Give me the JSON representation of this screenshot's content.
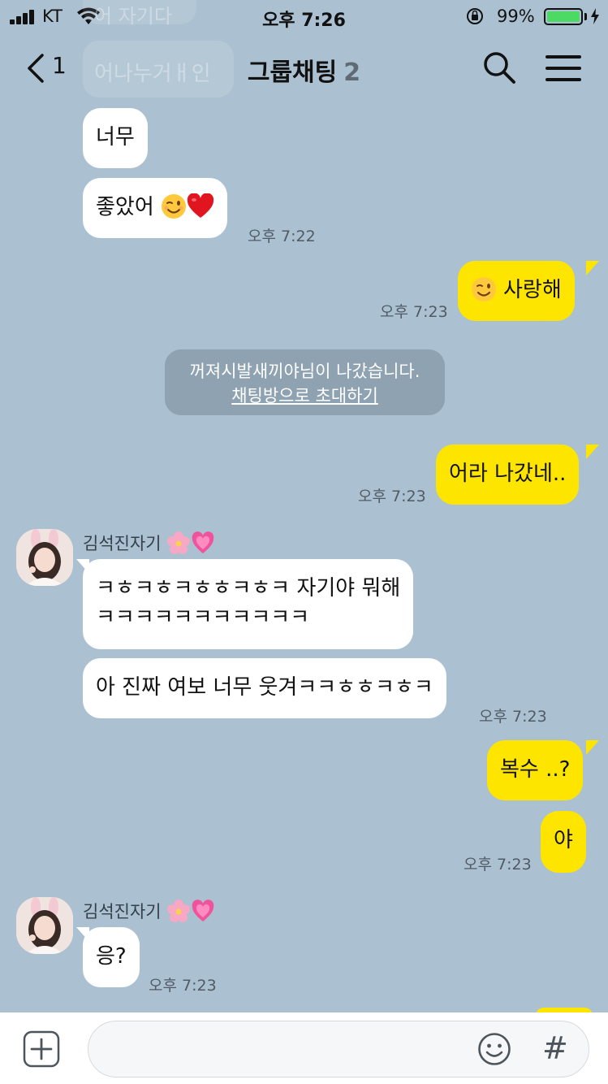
{
  "status_bar": {
    "carrier": "KT",
    "time": "오후 7:26",
    "battery_percent": "99%",
    "battery_level": 0.99
  },
  "header": {
    "unread_count": "1",
    "title": "그룹채팅",
    "member_count": "2",
    "ghost_text_top": "어 자기다",
    "ghost_text": "어나누거ㅐ인"
  },
  "messages": {
    "m1": "너무",
    "m2": "좋았어",
    "t1": "오후 7:22",
    "m3": "사랑해",
    "t2": "오후 7:23",
    "system_notice": "꺼져시발새끼야님이 나갔습니다.",
    "system_link": "채팅방으로 초대하기",
    "m4": "어라 나갔네..",
    "t3": "오후 7:23",
    "sender1": "김석진자기",
    "m5_line1": "ㅋㅎㅋㅎㅋㅎㅎㅋㅎㅋ 자기야 뭐해",
    "m5_line2": "ㅋㅋㅋㅋㅋㅋㅋㅋㅋㅋㅋ",
    "m6": "아 진짜 여보 너무 웃겨ㅋㅋㅎㅎㅋㅎㅋ",
    "t4": "오후 7:23",
    "m7": "복수 ..?",
    "m8": "야",
    "t5": "오후 7:23",
    "sender2": "김석진자기",
    "m9": "응?",
    "t6": "오후 7:23"
  },
  "input": {
    "hash": "#"
  },
  "colors": {
    "background": "#abc1d1",
    "my_bubble": "#fee500",
    "other_bubble": "#ffffff",
    "battery": "#4cd964"
  },
  "icons": [
    "back-chevron-icon",
    "search-icon",
    "menu-icon",
    "wink-emoji-icon",
    "heart-emoji-icon",
    "cherry-blossom-icon",
    "sparkling-heart-icon",
    "plus-icon",
    "smile-icon",
    "hash-icon"
  ]
}
